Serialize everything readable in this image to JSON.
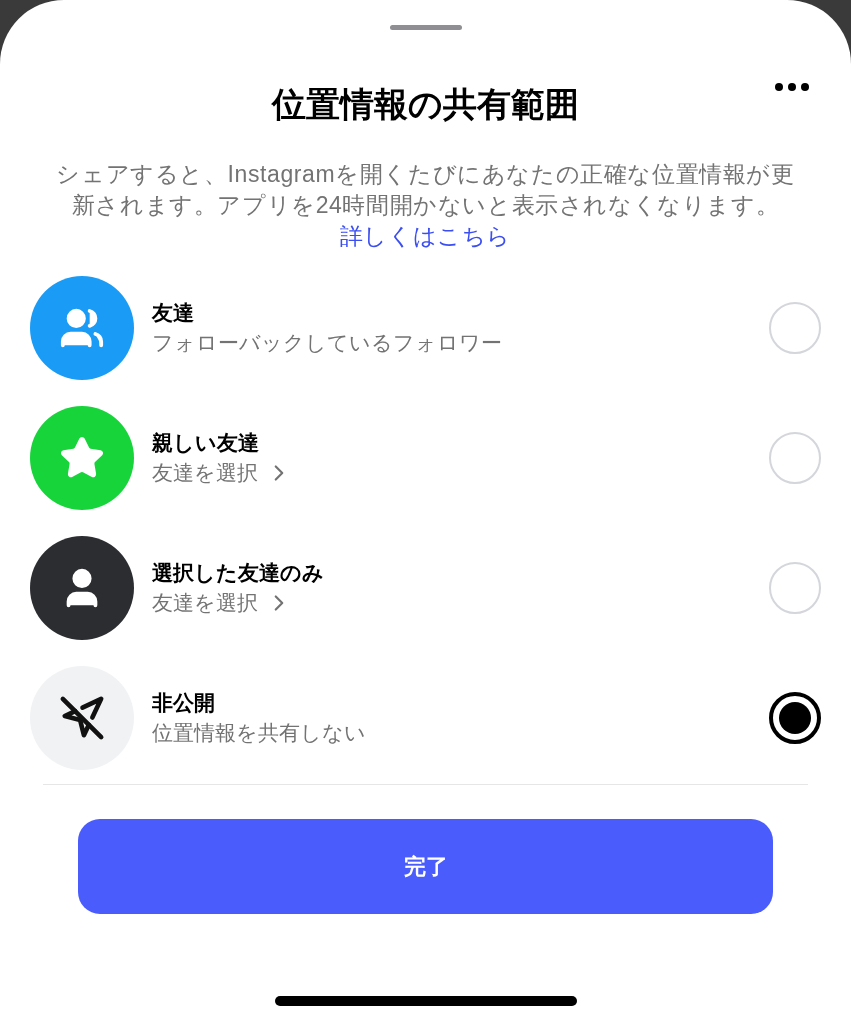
{
  "title": "位置情報の共有範囲",
  "description": {
    "text": "シェアすると、Instagramを開くたびにあなたの正確な位置情報が更新されます。アプリを24時間開かないと表示されなくなります。",
    "link": "詳しくはこちら"
  },
  "options": [
    {
      "kind": "friends",
      "color": "#1a9bf5",
      "title": "友達",
      "subtitle": "フォローバックしているフォロワー",
      "chevron": false,
      "selected": false
    },
    {
      "kind": "close_friends",
      "color": "#17d43a",
      "title": "親しい友達",
      "subtitle": "友達を選択",
      "chevron": true,
      "selected": false
    },
    {
      "kind": "chosen",
      "color": "#2c2d31",
      "title": "選択した友達のみ",
      "subtitle": "友達を選択",
      "chevron": true,
      "selected": false
    },
    {
      "kind": "private",
      "color": "#f1f2f4",
      "title": "非公開",
      "subtitle": "位置情報を共有しない",
      "chevron": false,
      "selected": true
    }
  ],
  "done_button": "完了"
}
